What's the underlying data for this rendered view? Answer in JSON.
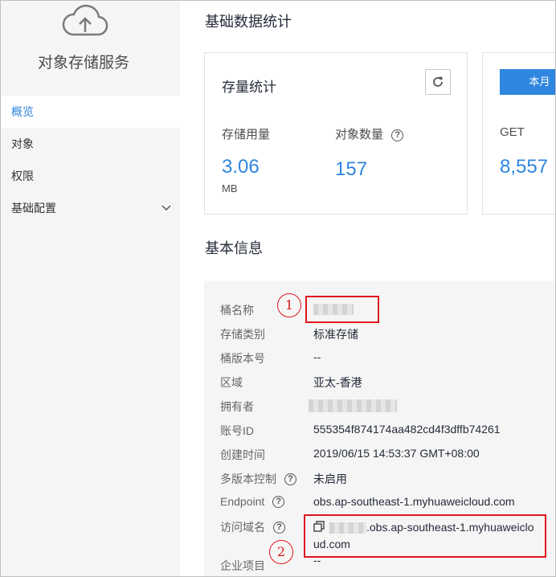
{
  "sidebar": {
    "service_title": "对象存储服务",
    "items": [
      {
        "label": "概览",
        "active": true
      },
      {
        "label": "对象",
        "active": false
      },
      {
        "label": "权限",
        "active": false
      },
      {
        "label": "基础配置",
        "active": false,
        "expandable": true
      }
    ]
  },
  "main": {
    "section_stats": "基础数据统计",
    "storage_card": {
      "title": "存量统计",
      "usage_label": "存储用量",
      "usage_value": "3.06",
      "usage_unit": "MB",
      "objects_label": "对象数量",
      "objects_value": "157"
    },
    "request_card": {
      "period_button": "本月",
      "get_label": "GET",
      "get_value": "8,557"
    },
    "section_info": "基本信息",
    "info_rows": [
      {
        "label": "桶名称",
        "value": ""
      },
      {
        "label": "存储类别",
        "value": "标准存储"
      },
      {
        "label": "桶版本号",
        "value": "--"
      },
      {
        "label": "区域",
        "value": "亚太-香港"
      },
      {
        "label": "拥有者",
        "value": ""
      },
      {
        "label": "账号ID",
        "value": "555354f874174aa482cd4f3dffb74261"
      },
      {
        "label": "创建时间",
        "value": "2019/06/15 14:53:37 GMT+08:00"
      },
      {
        "label": "多版本控制",
        "value": "未启用"
      },
      {
        "label": "Endpoint",
        "value": "obs.ap-southeast-1.myhuaweicloud.com"
      },
      {
        "label": "访问域名",
        "value_line1": ".obs.ap-southeast-1.myhuaweiclo",
        "value_line2": "ud.com"
      },
      {
        "label": "企业项目",
        "value": "--"
      }
    ]
  },
  "annotations": [
    "1",
    "2"
  ],
  "colors": {
    "accent": "#2e86de",
    "annotation": "#e0161d",
    "sidebar_bg": "#f5f5f5"
  }
}
